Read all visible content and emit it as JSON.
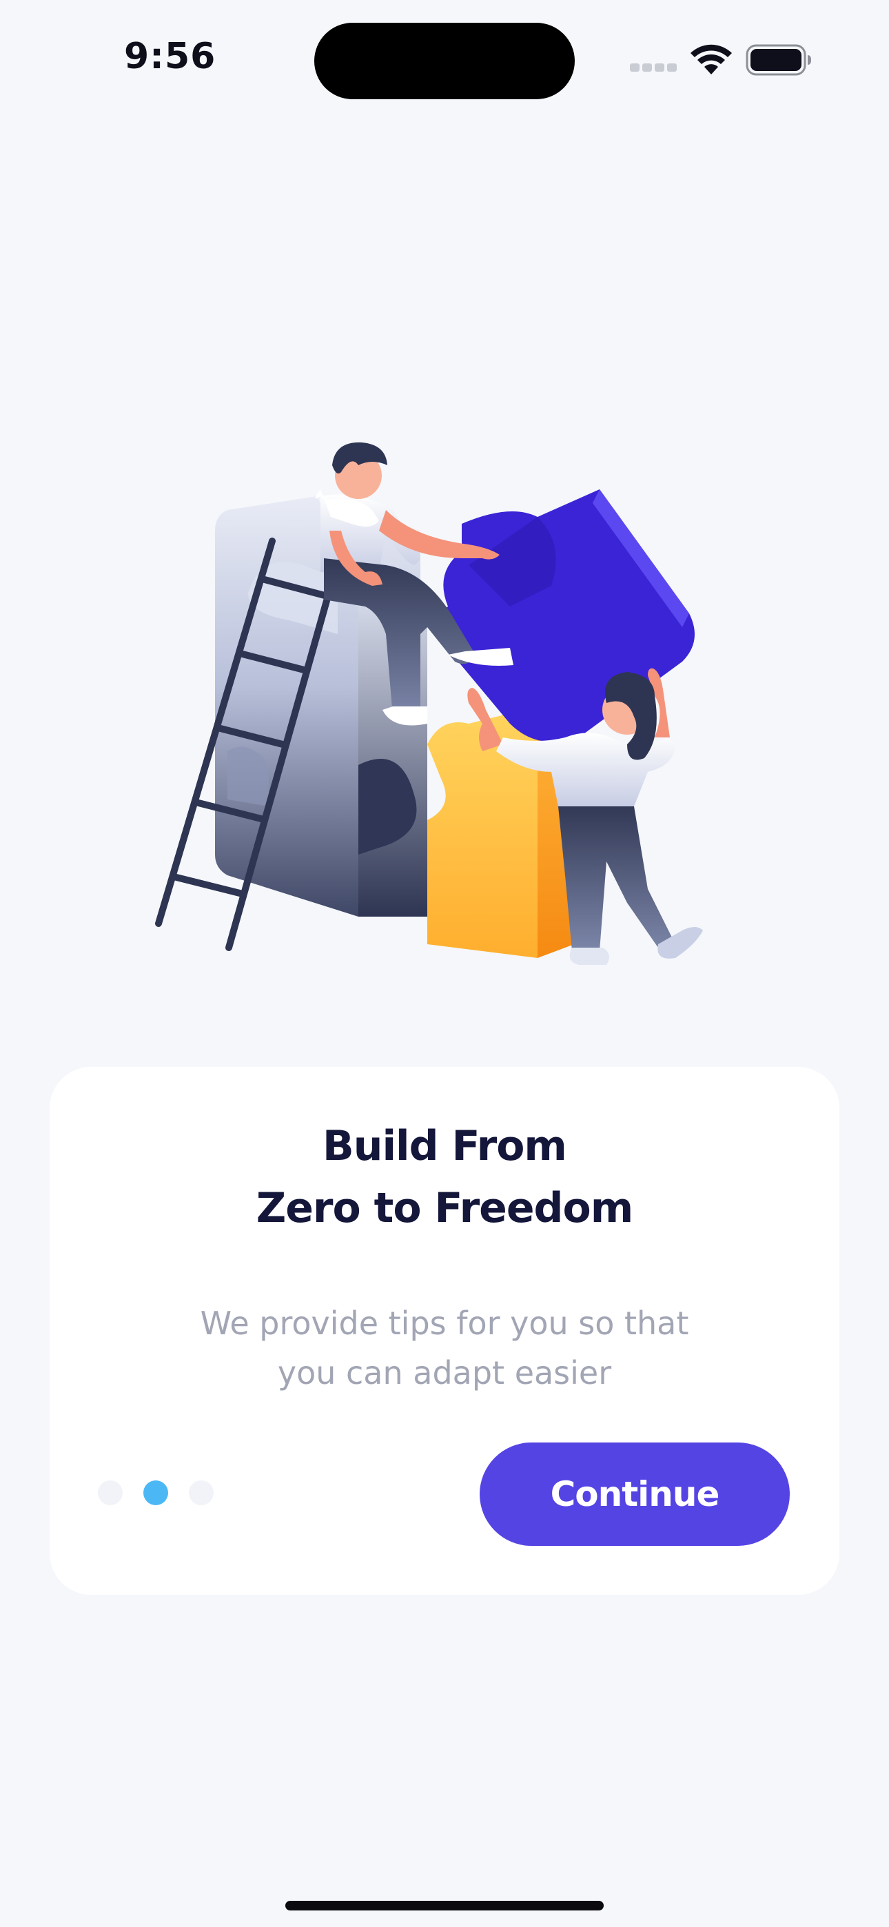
{
  "status_bar": {
    "time": "9:56",
    "icons": [
      "cellular-signal-icon",
      "wifi-icon",
      "battery-icon"
    ]
  },
  "illustration": {
    "name": "people-assembling-puzzle-illustration"
  },
  "onboarding": {
    "title_line_1": "Build From",
    "title_line_2": "Zero to Freedom",
    "subtitle_line_1": "We provide tips for you so that",
    "subtitle_line_2": "you can adapt easier",
    "page_count": 3,
    "active_page": 2,
    "continue_label": "Continue"
  },
  "colors": {
    "background": "#F5F7FB",
    "card": "#FFFFFF",
    "title": "#14163A",
    "subtitle": "#A2A5B4",
    "accent": "#5544E4",
    "active_dot": "#4CB7F5",
    "inactive_dot": "#F1F3F8",
    "puzzle_purple": "#3B24D6",
    "puzzle_yellow": "#FFC24A"
  }
}
